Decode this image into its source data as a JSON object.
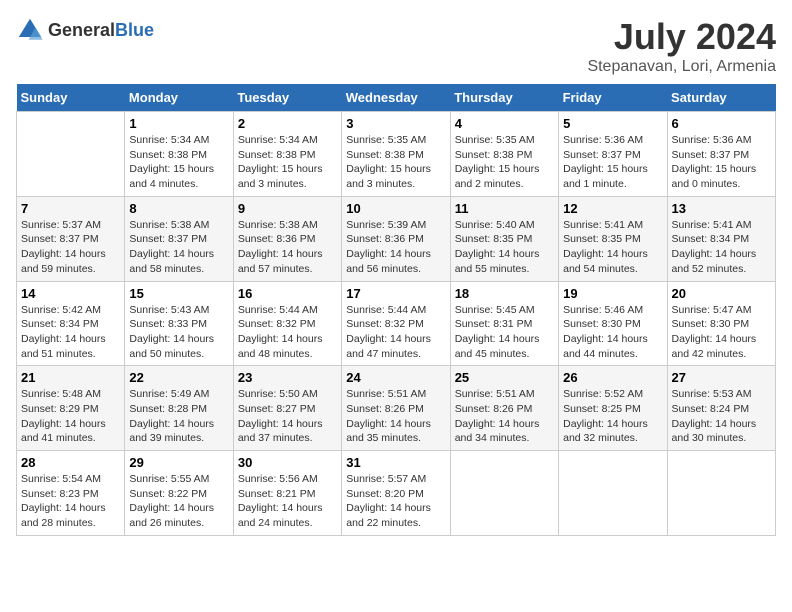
{
  "header": {
    "logo_general": "General",
    "logo_blue": "Blue",
    "month": "July 2024",
    "location": "Stepanavan, Lori, Armenia"
  },
  "weekdays": [
    "Sunday",
    "Monday",
    "Tuesday",
    "Wednesday",
    "Thursday",
    "Friday",
    "Saturday"
  ],
  "weeks": [
    [
      {
        "day": "",
        "sunrise": "",
        "sunset": "",
        "daylight": ""
      },
      {
        "day": "1",
        "sunrise": "Sunrise: 5:34 AM",
        "sunset": "Sunset: 8:38 PM",
        "daylight": "Daylight: 15 hours and 4 minutes."
      },
      {
        "day": "2",
        "sunrise": "Sunrise: 5:34 AM",
        "sunset": "Sunset: 8:38 PM",
        "daylight": "Daylight: 15 hours and 3 minutes."
      },
      {
        "day": "3",
        "sunrise": "Sunrise: 5:35 AM",
        "sunset": "Sunset: 8:38 PM",
        "daylight": "Daylight: 15 hours and 3 minutes."
      },
      {
        "day": "4",
        "sunrise": "Sunrise: 5:35 AM",
        "sunset": "Sunset: 8:38 PM",
        "daylight": "Daylight: 15 hours and 2 minutes."
      },
      {
        "day": "5",
        "sunrise": "Sunrise: 5:36 AM",
        "sunset": "Sunset: 8:37 PM",
        "daylight": "Daylight: 15 hours and 1 minute."
      },
      {
        "day": "6",
        "sunrise": "Sunrise: 5:36 AM",
        "sunset": "Sunset: 8:37 PM",
        "daylight": "Daylight: 15 hours and 0 minutes."
      }
    ],
    [
      {
        "day": "7",
        "sunrise": "Sunrise: 5:37 AM",
        "sunset": "Sunset: 8:37 PM",
        "daylight": "Daylight: 14 hours and 59 minutes."
      },
      {
        "day": "8",
        "sunrise": "Sunrise: 5:38 AM",
        "sunset": "Sunset: 8:37 PM",
        "daylight": "Daylight: 14 hours and 58 minutes."
      },
      {
        "day": "9",
        "sunrise": "Sunrise: 5:38 AM",
        "sunset": "Sunset: 8:36 PM",
        "daylight": "Daylight: 14 hours and 57 minutes."
      },
      {
        "day": "10",
        "sunrise": "Sunrise: 5:39 AM",
        "sunset": "Sunset: 8:36 PM",
        "daylight": "Daylight: 14 hours and 56 minutes."
      },
      {
        "day": "11",
        "sunrise": "Sunrise: 5:40 AM",
        "sunset": "Sunset: 8:35 PM",
        "daylight": "Daylight: 14 hours and 55 minutes."
      },
      {
        "day": "12",
        "sunrise": "Sunrise: 5:41 AM",
        "sunset": "Sunset: 8:35 PM",
        "daylight": "Daylight: 14 hours and 54 minutes."
      },
      {
        "day": "13",
        "sunrise": "Sunrise: 5:41 AM",
        "sunset": "Sunset: 8:34 PM",
        "daylight": "Daylight: 14 hours and 52 minutes."
      }
    ],
    [
      {
        "day": "14",
        "sunrise": "Sunrise: 5:42 AM",
        "sunset": "Sunset: 8:34 PM",
        "daylight": "Daylight: 14 hours and 51 minutes."
      },
      {
        "day": "15",
        "sunrise": "Sunrise: 5:43 AM",
        "sunset": "Sunset: 8:33 PM",
        "daylight": "Daylight: 14 hours and 50 minutes."
      },
      {
        "day": "16",
        "sunrise": "Sunrise: 5:44 AM",
        "sunset": "Sunset: 8:32 PM",
        "daylight": "Daylight: 14 hours and 48 minutes."
      },
      {
        "day": "17",
        "sunrise": "Sunrise: 5:44 AM",
        "sunset": "Sunset: 8:32 PM",
        "daylight": "Daylight: 14 hours and 47 minutes."
      },
      {
        "day": "18",
        "sunrise": "Sunrise: 5:45 AM",
        "sunset": "Sunset: 8:31 PM",
        "daylight": "Daylight: 14 hours and 45 minutes."
      },
      {
        "day": "19",
        "sunrise": "Sunrise: 5:46 AM",
        "sunset": "Sunset: 8:30 PM",
        "daylight": "Daylight: 14 hours and 44 minutes."
      },
      {
        "day": "20",
        "sunrise": "Sunrise: 5:47 AM",
        "sunset": "Sunset: 8:30 PM",
        "daylight": "Daylight: 14 hours and 42 minutes."
      }
    ],
    [
      {
        "day": "21",
        "sunrise": "Sunrise: 5:48 AM",
        "sunset": "Sunset: 8:29 PM",
        "daylight": "Daylight: 14 hours and 41 minutes."
      },
      {
        "day": "22",
        "sunrise": "Sunrise: 5:49 AM",
        "sunset": "Sunset: 8:28 PM",
        "daylight": "Daylight: 14 hours and 39 minutes."
      },
      {
        "day": "23",
        "sunrise": "Sunrise: 5:50 AM",
        "sunset": "Sunset: 8:27 PM",
        "daylight": "Daylight: 14 hours and 37 minutes."
      },
      {
        "day": "24",
        "sunrise": "Sunrise: 5:51 AM",
        "sunset": "Sunset: 8:26 PM",
        "daylight": "Daylight: 14 hours and 35 minutes."
      },
      {
        "day": "25",
        "sunrise": "Sunrise: 5:51 AM",
        "sunset": "Sunset: 8:26 PM",
        "daylight": "Daylight: 14 hours and 34 minutes."
      },
      {
        "day": "26",
        "sunrise": "Sunrise: 5:52 AM",
        "sunset": "Sunset: 8:25 PM",
        "daylight": "Daylight: 14 hours and 32 minutes."
      },
      {
        "day": "27",
        "sunrise": "Sunrise: 5:53 AM",
        "sunset": "Sunset: 8:24 PM",
        "daylight": "Daylight: 14 hours and 30 minutes."
      }
    ],
    [
      {
        "day": "28",
        "sunrise": "Sunrise: 5:54 AM",
        "sunset": "Sunset: 8:23 PM",
        "daylight": "Daylight: 14 hours and 28 minutes."
      },
      {
        "day": "29",
        "sunrise": "Sunrise: 5:55 AM",
        "sunset": "Sunset: 8:22 PM",
        "daylight": "Daylight: 14 hours and 26 minutes."
      },
      {
        "day": "30",
        "sunrise": "Sunrise: 5:56 AM",
        "sunset": "Sunset: 8:21 PM",
        "daylight": "Daylight: 14 hours and 24 minutes."
      },
      {
        "day": "31",
        "sunrise": "Sunrise: 5:57 AM",
        "sunset": "Sunset: 8:20 PM",
        "daylight": "Daylight: 14 hours and 22 minutes."
      },
      {
        "day": "",
        "sunrise": "",
        "sunset": "",
        "daylight": ""
      },
      {
        "day": "",
        "sunrise": "",
        "sunset": "",
        "daylight": ""
      },
      {
        "day": "",
        "sunrise": "",
        "sunset": "",
        "daylight": ""
      }
    ]
  ]
}
